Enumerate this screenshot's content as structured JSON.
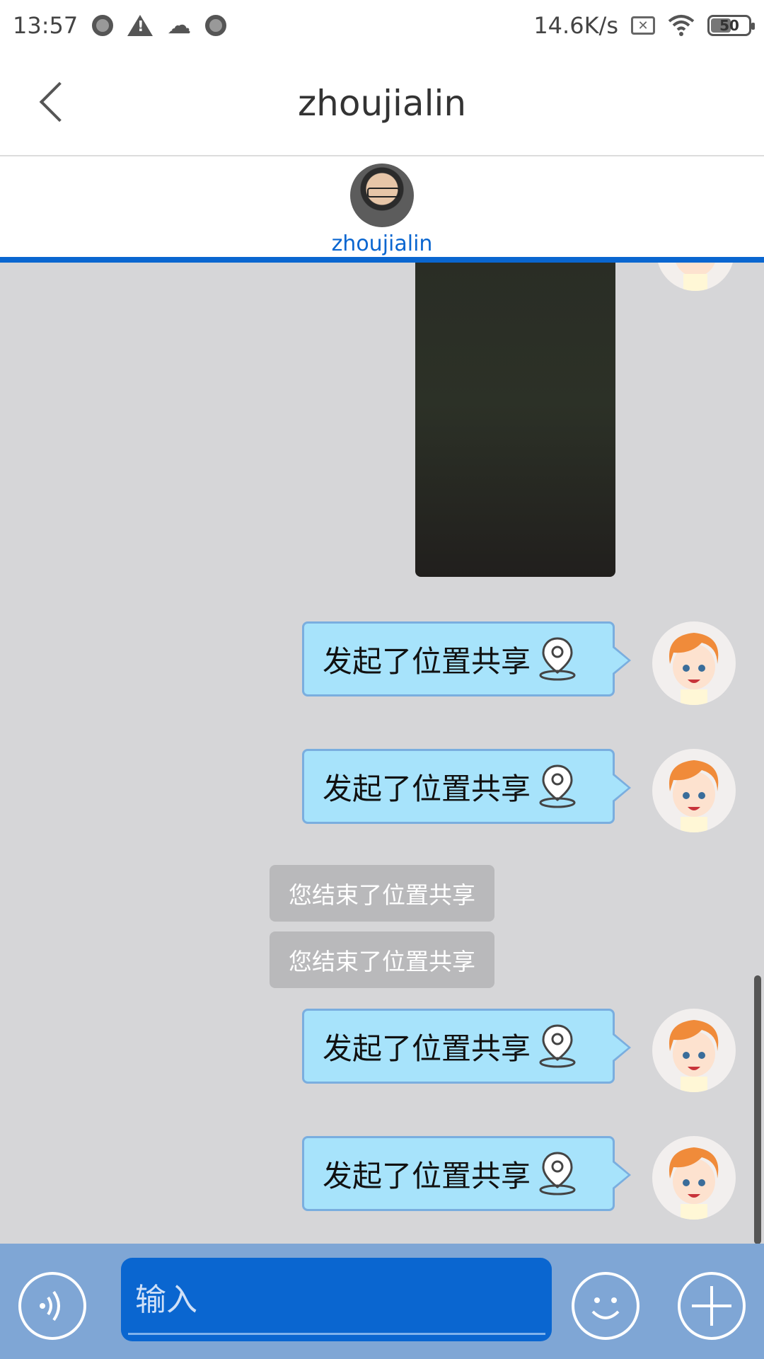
{
  "status_bar": {
    "time": "13:57",
    "network_speed": "14.6K/s",
    "battery_level": "50",
    "icons": [
      "record-icon",
      "warning-icon",
      "cloud-icon",
      "record-icon",
      "sim-no-signal-icon",
      "wifi-icon",
      "battery-icon"
    ]
  },
  "nav": {
    "title": "zhoujialin",
    "back_icon": "chevron-left-icon"
  },
  "participants": [
    {
      "name": "zhoujialin"
    }
  ],
  "messages": {
    "location_share_1": "发起了位置共享",
    "location_share_2": "发起了位置共享",
    "system_1": "您结束了位置共享",
    "system_2": "您结束了位置共享",
    "location_share_3": "发起了位置共享",
    "location_share_4": "发起了位置共享"
  },
  "input_bar": {
    "placeholder": "输入",
    "value": ""
  },
  "colors": {
    "accent": "#0a66d0",
    "bubble": "#a7e3fb",
    "bubble_border": "#7aaedf",
    "input_bar": "#7fa6d5",
    "chat_background": "#d6d6d8"
  }
}
